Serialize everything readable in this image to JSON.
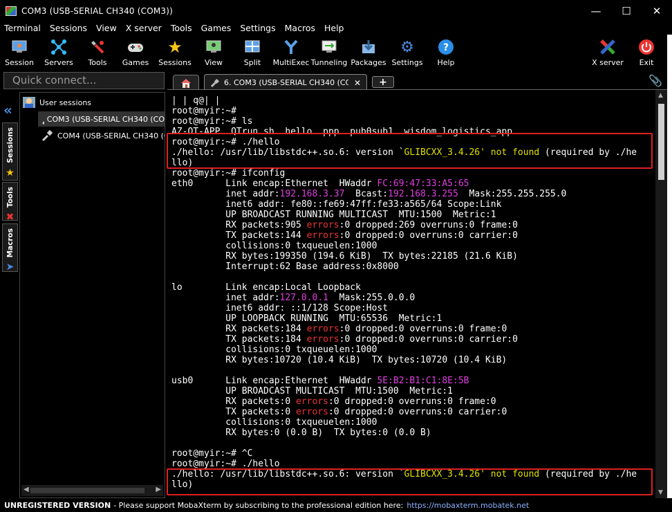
{
  "window": {
    "title": "COM3  (USB-SERIAL CH340 (COM3))"
  },
  "menu": [
    "Terminal",
    "Sessions",
    "View",
    "X server",
    "Tools",
    "Games",
    "Settings",
    "Macros",
    "Help"
  ],
  "toolbar": {
    "session": "Session",
    "servers": "Servers",
    "tools": "Tools",
    "games": "Games",
    "sessions": "Sessions",
    "view": "View",
    "split": "Split",
    "multiexec": "MultiExec",
    "tunneling": "Tunneling",
    "packages": "Packages",
    "settings": "Settings",
    "help": "Help",
    "xserver": "X server",
    "exit": "Exit"
  },
  "quick_connect": {
    "placeholder": "Quick connect..."
  },
  "tabs": {
    "active_label": "6. COM3  (USB-SERIAL CH340 (CC",
    "add": "+"
  },
  "sidebar": {
    "vertical_tabs": [
      "Sessions",
      "Tools",
      "Macros"
    ],
    "root": "User sessions",
    "items": [
      "COM3  (USB-SERIAL CH340 (CO",
      "COM4  (USB-SERIAL CH340 (CO"
    ]
  },
  "terminal": {
    "lines": [
      "| | q@| |",
      "root@myir:~#",
      "root@myir:~# ls",
      "AZ-OT-APP  QTrun.sh  hello  ppp  pub0sub1  wisdom_logistics_app",
      "root@myir:~# ./hello",
      "./hello: /usr/lib/libstdc++.so.6: version `GLIBCXX_3.4.26' not found (required by ./he",
      "llo)",
      "root@myir:~# ifconfig",
      "eth0      Link encap:Ethernet  HWaddr FC:69:47:33:A5:65",
      "          inet addr:192.168.3.37  Bcast:192.168.3.255  Mask:255.255.255.0",
      "          inet6 addr: fe80::fe69:47ff:fe33:a565/64 Scope:Link",
      "          UP BROADCAST RUNNING MULTICAST  MTU:1500  Metric:1",
      "          RX packets:905 errors:0 dropped:269 overruns:0 frame:0",
      "          TX packets:144 errors:0 dropped:0 overruns:0 carrier:0",
      "          collisions:0 txqueuelen:1000",
      "          RX bytes:199350 (194.6 KiB)  TX bytes:22185 (21.6 KiB)",
      "          Interrupt:62 Base address:0x8000",
      "",
      "lo        Link encap:Local Loopback",
      "          inet addr:127.0.0.1  Mask:255.0.0.0",
      "          inet6 addr: ::1/128 Scope:Host",
      "          UP LOOPBACK RUNNING  MTU:65536  Metric:1",
      "          RX packets:184 errors:0 dropped:0 overruns:0 frame:0",
      "          TX packets:184 errors:0 dropped:0 overruns:0 carrier:0",
      "          collisions:0 txqueuelen:1000",
      "          RX bytes:10720 (10.4 KiB)  TX bytes:10720 (10.4 KiB)",
      "",
      "usb0      Link encap:Ethernet  HWaddr 5E:B2:B1:C1:8E:5B",
      "          UP BROADCAST MULTICAST  MTU:1500  Metric:1",
      "          RX packets:0 errors:0 dropped:0 overruns:0 frame:0",
      "          TX packets:0 errors:0 dropped:0 overruns:0 carrier:0",
      "          collisions:0 txqueuelen:1000",
      "          RX bytes:0 (0.0 B)  TX bytes:0 (0.0 B)",
      "",
      "root@myir:~# ^C",
      "root@myir:~# ./hello",
      "./hello: /usr/lib/libstdc++.so.6: version `GLIBCXX_3.4.26' not found (required by ./he",
      "llo)"
    ],
    "colors": {
      "magenta": "#e03ee0",
      "yellow": "#e0e000",
      "red": "#e33",
      "highlight_box": "#e02020"
    }
  },
  "statusbar": {
    "unregistered": "UNREGISTERED VERSION",
    "message": " -  Please support MobaXterm by subscribing to the professional edition here:",
    "url": "https://mobaxterm.mobatek.net"
  }
}
